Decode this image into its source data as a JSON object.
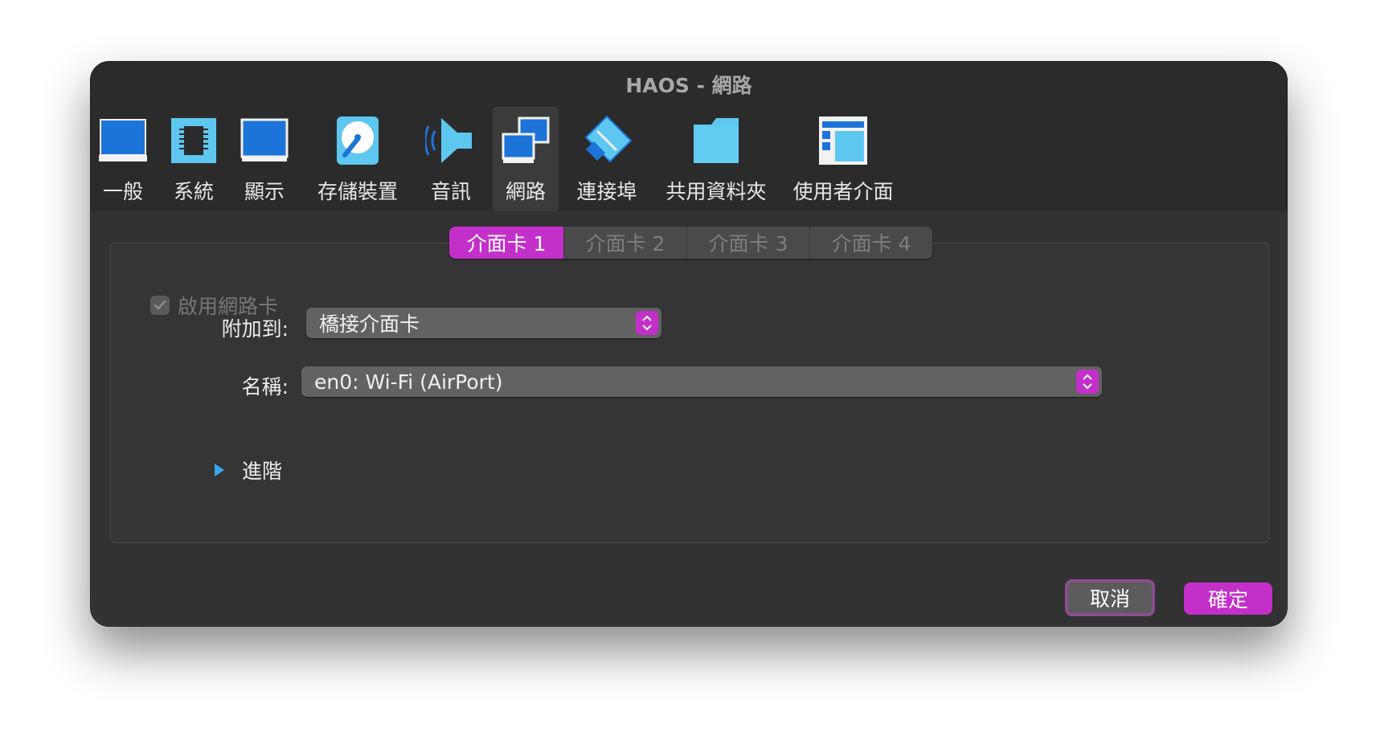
{
  "window": {
    "title": "HAOS - 網路"
  },
  "toolbar": {
    "items": [
      {
        "label": "一般",
        "icon": "general-monitor-icon"
      },
      {
        "label": "系統",
        "icon": "chip-icon"
      },
      {
        "label": "顯示",
        "icon": "display-icon"
      },
      {
        "label": "存儲裝置",
        "icon": "storage-disk-icon"
      },
      {
        "label": "音訊",
        "icon": "speaker-icon"
      },
      {
        "label": "網路",
        "icon": "network-icon"
      },
      {
        "label": "連接埠",
        "icon": "serial-port-icon"
      },
      {
        "label": "共用資料夾",
        "icon": "folder-icon"
      },
      {
        "label": "使用者介面",
        "icon": "user-interface-icon"
      }
    ],
    "active": "網路"
  },
  "tabs": {
    "items": [
      "介面卡 1",
      "介面卡 2",
      "介面卡 3",
      "介面卡 4"
    ],
    "active": "介面卡 1"
  },
  "form": {
    "enable_label": "啟用網路卡",
    "enable_checked": true,
    "attach_label": "附加到:",
    "attach_value": "橋接介面卡",
    "name_label": "名稱:",
    "name_value": "en0: Wi-Fi (AirPort)",
    "advanced_label": "進階"
  },
  "buttons": {
    "cancel": "取消",
    "ok": "確定"
  },
  "colors": {
    "accent": "#c330c9",
    "icon_blue": "#1d74d8",
    "disclosure": "#3aa7f0"
  }
}
